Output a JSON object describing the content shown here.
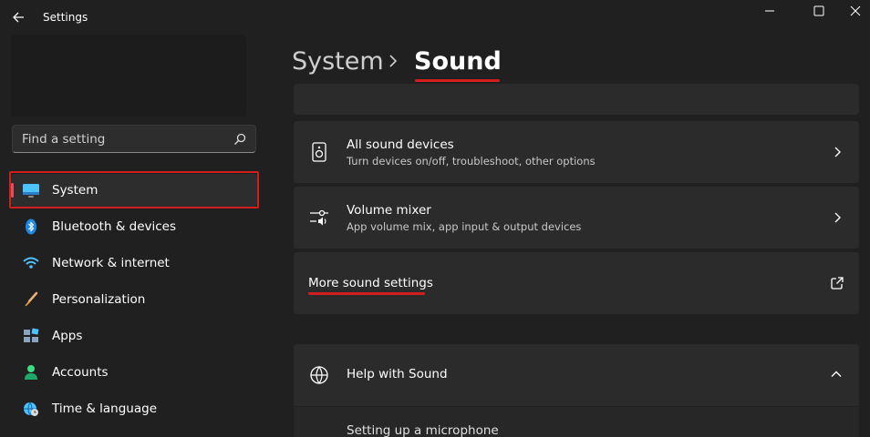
{
  "window": {
    "title": "Settings",
    "controls": [
      "minimize",
      "maximize",
      "close"
    ]
  },
  "search": {
    "placeholder": "Find a setting",
    "icon": "search-icon"
  },
  "sidebar": {
    "items": [
      {
        "label": "System",
        "icon": "monitor-icon",
        "active": true
      },
      {
        "label": "Bluetooth & devices",
        "icon": "bluetooth-icon"
      },
      {
        "label": "Network & internet",
        "icon": "wifi-icon"
      },
      {
        "label": "Personalization",
        "icon": "brush-icon"
      },
      {
        "label": "Apps",
        "icon": "apps-icon"
      },
      {
        "label": "Accounts",
        "icon": "person-icon"
      },
      {
        "label": "Time & language",
        "icon": "globe-clock-icon"
      }
    ]
  },
  "header": {
    "parent": "System",
    "current": "Sound"
  },
  "cards": {
    "all_devices": {
      "title": "All sound devices",
      "subtitle": "Turn devices on/off, troubleshoot, other options"
    },
    "volume_mixer": {
      "title": "Volume mixer",
      "subtitle": "App volume mix, app input & output devices"
    },
    "more_settings": {
      "title": "More sound settings"
    },
    "help": {
      "title": "Help with Sound",
      "item": "Setting up a microphone"
    }
  },
  "colors": {
    "background": "#202020",
    "card": "#2b2b2b",
    "accent": "#e05060",
    "annotation": "#d21e1e"
  }
}
